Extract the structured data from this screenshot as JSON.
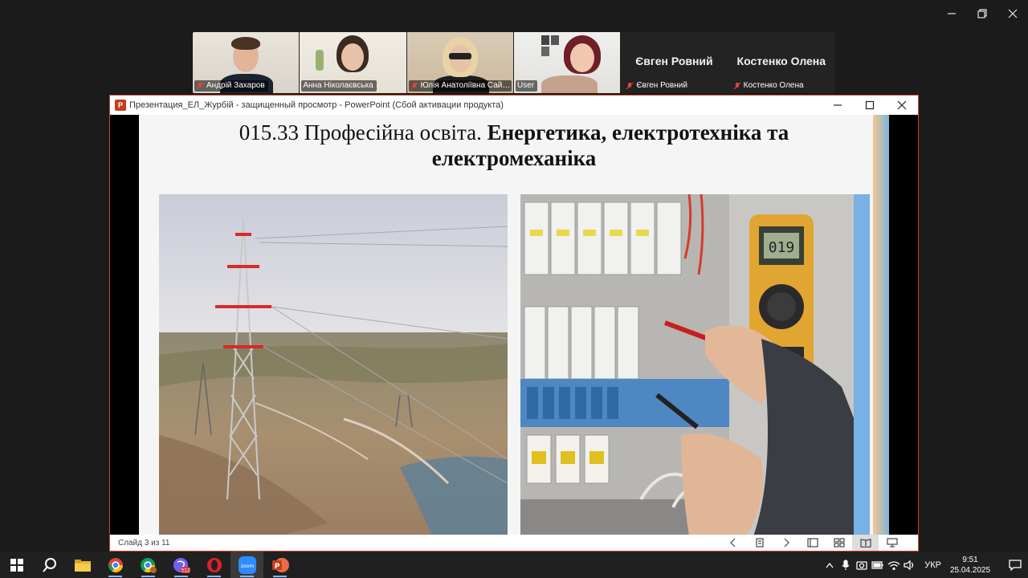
{
  "zoom": {
    "participants": [
      {
        "name": "Андрій Захаров",
        "muted": true,
        "video": true
      },
      {
        "name": "Анна Ніколаєвська",
        "muted": false,
        "video": true
      },
      {
        "name": "Юлія Анатоліївна Сай…",
        "muted": true,
        "video": true
      },
      {
        "name": "User",
        "muted": false,
        "video": true,
        "active_speaker": true
      },
      {
        "name": "Євген Ровний",
        "muted": true,
        "video": false
      },
      {
        "name": "Костенко Олена",
        "muted": true,
        "video": false
      }
    ],
    "active_color": "#2bd150"
  },
  "powerpoint": {
    "title": "Презентация_ЕЛ_Журбій  -  защищенный просмотр - PowerPoint (Сбой активации продукта)",
    "slide": {
      "title_regular": "015.33 Професійна освіта. ",
      "title_bold_1": "Енергетика, електротехніка та",
      "title_bold_2": "електромеханіка"
    },
    "status": {
      "slide_count": "Слайд 3 из 11"
    },
    "accent": "#c43e1c"
  },
  "taskbar": {
    "apps": [
      "start",
      "search",
      "file-explorer",
      "chrome",
      "chrome-profile",
      "viber",
      "opera",
      "zoom",
      "powerpoint"
    ],
    "viber_badge": "312",
    "zoom_label": "zoom",
    "language": "УКР",
    "time": "9:51",
    "date": "25.04.2025"
  }
}
